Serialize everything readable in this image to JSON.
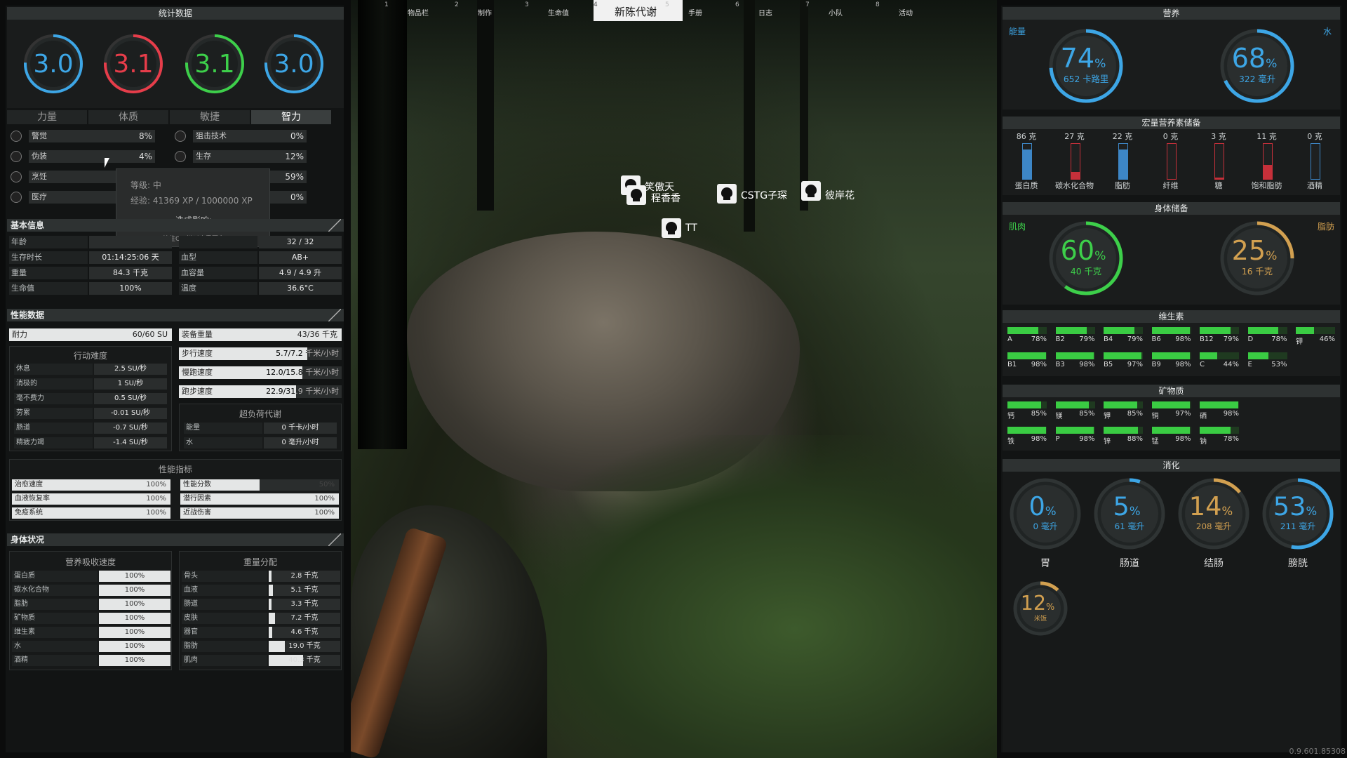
{
  "top_tabs": [
    {
      "num": "1",
      "label": "物品栏"
    },
    {
      "num": "2",
      "label": "制作"
    },
    {
      "num": "3",
      "label": "生命值"
    },
    {
      "num": "4",
      "label": "新陈代谢"
    },
    {
      "num": "5",
      "label": "手册"
    },
    {
      "num": "6",
      "label": "日志"
    },
    {
      "num": "7",
      "label": "小队"
    },
    {
      "num": "8",
      "label": "活动"
    }
  ],
  "stats": {
    "title": "统计数据",
    "gauges": [
      {
        "value": "3.0",
        "color": "#3da6e6"
      },
      {
        "value": "3.1",
        "color": "#e63d4a"
      },
      {
        "value": "3.1",
        "color": "#3dcf4a"
      },
      {
        "value": "3.0",
        "color": "#3da6e6"
      }
    ],
    "attr_tabs": [
      "力量",
      "体质",
      "敏捷",
      "智力"
    ],
    "skills": [
      {
        "name": "警觉",
        "pct": "8%"
      },
      {
        "name": "伪装",
        "pct": "4%"
      },
      {
        "name": "烹饪",
        "pct": ""
      },
      {
        "name": "医疗",
        "pct": ""
      },
      {
        "name": "狙击技术",
        "pct": "0%"
      },
      {
        "name": "生存",
        "pct": "12%"
      },
      {
        "name": "",
        "pct": "59%"
      },
      {
        "name": "",
        "pct": "0%"
      }
    ],
    "tooltip": {
      "level": "等级: 中",
      "xp": "经验: 41369 XP / 1000000 XP",
      "effect": "造成影响:",
      "hint": "按住Ctrl键以查看更多"
    }
  },
  "basic": {
    "title": "基本信息",
    "rows": [
      {
        "label": "年龄",
        "value": ""
      },
      {
        "label": "生存时长",
        "value": "01:14:25:06 天"
      },
      {
        "label": "重量",
        "value": "84.3 千克"
      },
      {
        "label": "生命值",
        "value": "100%"
      }
    ],
    "rows2": [
      {
        "label": "",
        "value": "32 / 32"
      },
      {
        "label": "血型",
        "value": "AB+"
      },
      {
        "label": "血容量",
        "value": "4.9 / 4.9 升"
      },
      {
        "label": "温度",
        "value": "36.6°C"
      }
    ]
  },
  "perf": {
    "title": "性能数据",
    "stamina": {
      "label": "耐力",
      "value": "60/60 SU"
    },
    "equip": {
      "label": "装备重量",
      "value": "43/36 千克"
    },
    "difficulty_title": "行动难度",
    "difficulty": [
      {
        "label": "休息",
        "value": "2.5 SU/秒"
      },
      {
        "label": "消极的",
        "value": "1 SU/秒"
      },
      {
        "label": "毫不费力",
        "value": "0.5 SU/秒"
      },
      {
        "label": "劳累",
        "value": "-0.01 SU/秒"
      },
      {
        "label": "肠道",
        "value": "-0.7 SU/秒"
      },
      {
        "label": "精疲力竭",
        "value": "-1.4 SU/秒"
      }
    ],
    "speeds": [
      {
        "label": "步行速度",
        "value": "5.7/7.2 千米/小时",
        "fill": 0.79
      },
      {
        "label": "慢跑速度",
        "value": "12.0/15.8 千米/小时",
        "fill": 0.76
      },
      {
        "label": "跑步速度",
        "value": "22.9/31.9 千米/小时",
        "fill": 0.72
      }
    ],
    "overload_title": "超负荷代谢",
    "overload": [
      {
        "label": "能量",
        "value": "0 千卡/小时"
      },
      {
        "label": "水",
        "value": "0 毫升/小时"
      }
    ],
    "indicators_title": "性能指标",
    "indicators": [
      {
        "label": "治愈速度",
        "value": "100%",
        "fill": 1
      },
      {
        "label": "血液恢复率",
        "value": "100%",
        "fill": 1
      },
      {
        "label": "免疫系统",
        "value": "100%",
        "fill": 1
      },
      {
        "label": "性能分数",
        "value": "50%",
        "fill": 0.5
      },
      {
        "label": "潜行因素",
        "value": "100%",
        "fill": 1
      },
      {
        "label": "近战伤害",
        "value": "100%",
        "fill": 1
      }
    ]
  },
  "body": {
    "title": "身体状况",
    "absorb_title": "营养吸收速度",
    "absorb": [
      {
        "label": "蛋白质",
        "value": "100%"
      },
      {
        "label": "碳水化合物",
        "value": "100%"
      },
      {
        "label": "脂肪",
        "value": "100%"
      },
      {
        "label": "矿物质",
        "value": "100%"
      },
      {
        "label": "维生素",
        "value": "100%"
      },
      {
        "label": "水",
        "value": "100%"
      },
      {
        "label": "酒精",
        "value": "100%"
      }
    ],
    "weight_title": "重量分配",
    "weight": [
      {
        "label": "骨头",
        "value": "2.8 千克",
        "fill": 0.04
      },
      {
        "label": "血液",
        "value": "5.1 千克",
        "fill": 0.06
      },
      {
        "label": "肠道",
        "value": "3.3 千克",
        "fill": 0.04
      },
      {
        "label": "皮肤",
        "value": "7.2 千克",
        "fill": 0.09
      },
      {
        "label": "器官",
        "value": "4.6 千克",
        "fill": 0.05
      },
      {
        "label": "脂肪",
        "value": "19.0 千克",
        "fill": 0.23
      },
      {
        "label": "肌肉",
        "value": "40.3 千克",
        "fill": 0.48
      }
    ]
  },
  "markers": [
    {
      "name": "笑傲天"
    },
    {
      "name": "程香香"
    },
    {
      "name": "CSTG子琛"
    },
    {
      "name": "彼岸花"
    },
    {
      "name": "TT"
    }
  ],
  "nutrition": {
    "title": "营养",
    "energy_label": "能量",
    "water_label": "水",
    "energy": {
      "pct": "74",
      "sub": "652 卡路里",
      "fraction": 0.74,
      "color": "#3da6e6"
    },
    "water": {
      "pct": "68",
      "sub": "322 毫升",
      "fraction": 0.68,
      "color": "#3da6e6"
    }
  },
  "macros": {
    "title": "宏量营养素储备",
    "items": [
      {
        "amount": "86 克",
        "name": "蛋白质",
        "level": 0.85,
        "color": "#3d86c6"
      },
      {
        "amount": "27 克",
        "name": "碳水化合物",
        "level": 0.2,
        "color": "#c6303a"
      },
      {
        "amount": "22 克",
        "name": "脂肪",
        "level": 0.85,
        "color": "#3d86c6"
      },
      {
        "amount": "0 克",
        "name": "纤维",
        "level": 0.0,
        "color": "#c6303a"
      },
      {
        "amount": "3 克",
        "name": "糖",
        "level": 0.05,
        "color": "#c6303a"
      },
      {
        "amount": "11 克",
        "name": "饱和脂肪",
        "level": 0.4,
        "color": "#c6303a"
      },
      {
        "amount": "0 克",
        "name": "酒精",
        "level": 0.0,
        "color": "#3d86c6"
      }
    ]
  },
  "reserves": {
    "title": "身体储备",
    "muscle_label": "肌肉",
    "fat_label": "脂肪",
    "muscle": {
      "pct": "60",
      "sub": "40 千克",
      "fraction": 0.6,
      "color": "#3dcf4a"
    },
    "fat": {
      "pct": "25",
      "sub": "16 千克",
      "fraction": 0.25,
      "color": "#d2a050"
    }
  },
  "vitamins": {
    "title": "维生素",
    "items": [
      {
        "name": "A",
        "pct": "78%",
        "fill": 0.78
      },
      {
        "name": "B2",
        "pct": "79%",
        "fill": 0.79
      },
      {
        "name": "B4",
        "pct": "79%",
        "fill": 0.79
      },
      {
        "name": "B6",
        "pct": "98%",
        "fill": 0.98
      },
      {
        "name": "B12",
        "pct": "79%",
        "fill": 0.79
      },
      {
        "name": "D",
        "pct": "78%",
        "fill": 0.78
      },
      {
        "name": "钾",
        "pct": "46%",
        "fill": 0.46
      },
      {
        "name": "B1",
        "pct": "98%",
        "fill": 0.98
      },
      {
        "name": "B3",
        "pct": "98%",
        "fill": 0.98
      },
      {
        "name": "B5",
        "pct": "97%",
        "fill": 0.97
      },
      {
        "name": "B9",
        "pct": "98%",
        "fill": 0.98
      },
      {
        "name": "C",
        "pct": "44%",
        "fill": 0.44
      },
      {
        "name": "E",
        "pct": "53%",
        "fill": 0.53
      }
    ]
  },
  "minerals": {
    "title": "矿物质",
    "items": [
      {
        "name": "钙",
        "pct": "85%",
        "fill": 0.85
      },
      {
        "name": "镁",
        "pct": "85%",
        "fill": 0.85
      },
      {
        "name": "钾",
        "pct": "85%",
        "fill": 0.85
      },
      {
        "name": "铜",
        "pct": "97%",
        "fill": 0.97
      },
      {
        "name": "硒",
        "pct": "98%",
        "fill": 0.98
      },
      {
        "name": "铁",
        "pct": "98%",
        "fill": 0.98
      },
      {
        "name": "P",
        "pct": "98%",
        "fill": 0.98
      },
      {
        "name": "锌",
        "pct": "88%",
        "fill": 0.88
      },
      {
        "name": "锰",
        "pct": "98%",
        "fill": 0.98
      },
      {
        "name": "钠",
        "pct": "78%",
        "fill": 0.78
      }
    ]
  },
  "digestion": {
    "title": "消化",
    "items": [
      {
        "pct": "0",
        "sub": "0 毫升",
        "name": "胃",
        "fraction": 0.0,
        "color": "#3da6e6"
      },
      {
        "pct": "5",
        "sub": "61 毫升",
        "name": "肠道",
        "fraction": 0.05,
        "color": "#3da6e6"
      },
      {
        "pct": "14",
        "sub": "208 毫升",
        "name": "结肠",
        "fraction": 0.14,
        "color": "#d2a050"
      },
      {
        "pct": "53",
        "sub": "211 毫升",
        "name": "膀胱",
        "fraction": 0.53,
        "color": "#3da6e6"
      }
    ],
    "food": {
      "pct": "12",
      "sub": "米饭",
      "fraction": 0.12,
      "color": "#d2a050"
    }
  },
  "version": "0.9.601.85308"
}
